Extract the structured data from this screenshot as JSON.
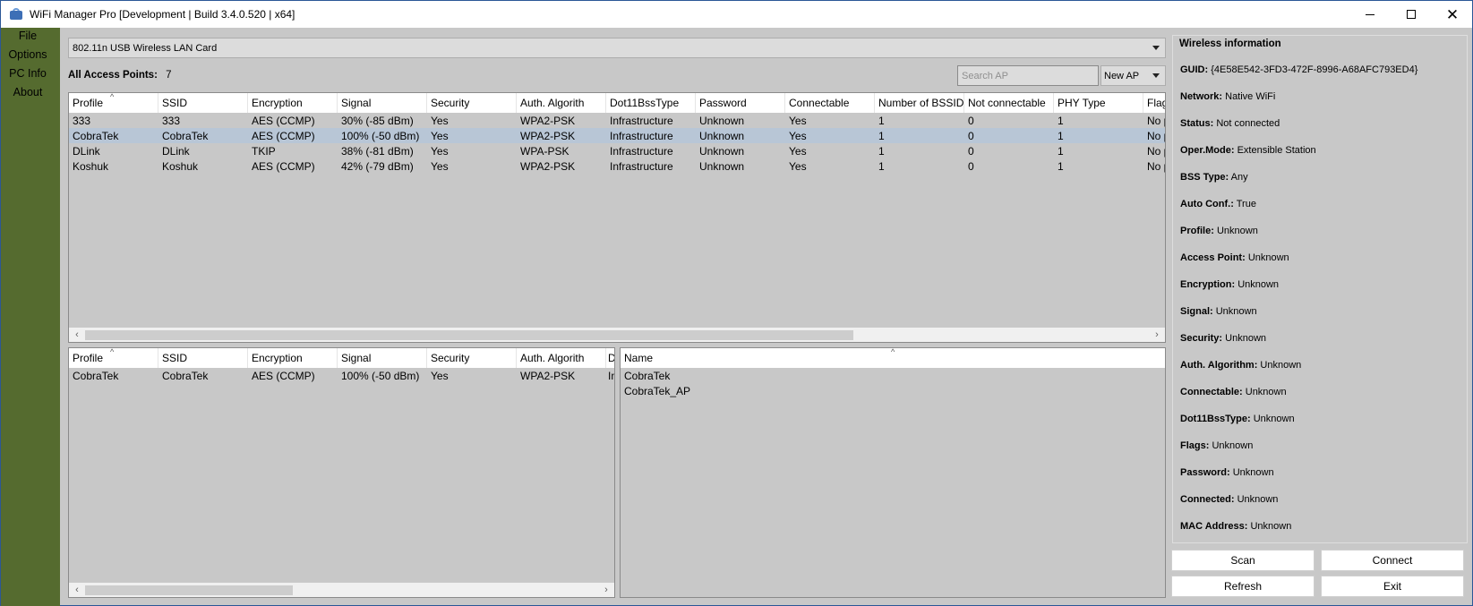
{
  "window": {
    "title": "WiFi Manager Pro [Development | Build 3.4.0.520 | x64]",
    "close_glyph": "✕"
  },
  "sidebar": {
    "items": [
      {
        "label": "File"
      },
      {
        "label": "Options"
      },
      {
        "label": "PC Info"
      },
      {
        "label": "About"
      }
    ]
  },
  "device": {
    "selected": "802.11n USB Wireless LAN Card"
  },
  "access_points": {
    "label": "All Access Points:",
    "count": "7"
  },
  "search": {
    "placeholder": "Search AP"
  },
  "new_ap": {
    "selected": "New AP"
  },
  "ap_table": {
    "columns": [
      "Profile",
      "SSID",
      "Encryption",
      "Signal",
      "Security",
      "Auth. Algorith",
      "Dot11BssType",
      "Password",
      "Connectable",
      "Number of BSSID",
      "Not connectable",
      "PHY Type",
      "Flags"
    ],
    "rows": [
      [
        "333",
        "333",
        "AES (CCMP)",
        "30% (-85 dBm)",
        "Yes",
        "WPA2-PSK",
        "Infrastructure",
        "Unknown",
        "Yes",
        "1",
        "0",
        "1",
        "No p"
      ],
      [
        "CobraTek",
        "CobraTek",
        "AES (CCMP)",
        "100% (-50 dBm)",
        "Yes",
        "WPA2-PSK",
        "Infrastructure",
        "Unknown",
        "Yes",
        "1",
        "0",
        "1",
        "No p"
      ],
      [
        "DLink",
        "DLink",
        "TKIP",
        "38% (-81 dBm)",
        "Yes",
        "WPA-PSK",
        "Infrastructure",
        "Unknown",
        "Yes",
        "1",
        "0",
        "1",
        "No p"
      ],
      [
        "Koshuk",
        "Koshuk",
        "AES (CCMP)",
        "42% (-79 dBm)",
        "Yes",
        "WPA2-PSK",
        "Infrastructure",
        "Unknown",
        "Yes",
        "1",
        "0",
        "1",
        "No p"
      ]
    ],
    "selected_row": 1
  },
  "selected_table": {
    "columns": [
      "Profile",
      "SSID",
      "Encryption",
      "Signal",
      "Security",
      "Auth. Algorith",
      "D"
    ],
    "rows": [
      [
        "CobraTek",
        "CobraTek",
        "AES (CCMP)",
        "100% (-50 dBm)",
        "Yes",
        "WPA2-PSK",
        "In"
      ]
    ]
  },
  "names_table": {
    "columns": [
      "Name"
    ],
    "rows": [
      [
        "CobraTek"
      ],
      [
        "CobraTek_AP"
      ]
    ]
  },
  "scroll_arrows": {
    "left": "‹",
    "right": "›",
    "sort": "^"
  },
  "info": {
    "title": "Wireless information",
    "fields": [
      {
        "key": "GUID:",
        "value": "{4E58E542-3FD3-472F-8996-A68AFC793ED4}"
      },
      {
        "key": "Network:",
        "value": "Native WiFi"
      },
      {
        "key": "Status:",
        "value": "Not connected"
      },
      {
        "key": "Oper.Mode:",
        "value": "Extensible Station"
      },
      {
        "key": "BSS Type:",
        "value": "Any"
      },
      {
        "key": "Auto Conf.:",
        "value": "True"
      },
      {
        "key": "Profile:",
        "value": "Unknown"
      },
      {
        "key": "Access Point:",
        "value": "Unknown"
      },
      {
        "key": "Encryption:",
        "value": "Unknown"
      },
      {
        "key": "Signal:",
        "value": "Unknown"
      },
      {
        "key": "Security:",
        "value": "Unknown"
      },
      {
        "key": "Auth. Algorithm:",
        "value": "Unknown"
      },
      {
        "key": "Connectable:",
        "value": "Unknown"
      },
      {
        "key": "Dot11BssType:",
        "value": "Unknown"
      },
      {
        "key": "Flags:",
        "value": "Unknown"
      },
      {
        "key": "Password:",
        "value": "Unknown"
      },
      {
        "key": "Connected:",
        "value": "Unknown"
      },
      {
        "key": "MAC Address:",
        "value": "Unknown"
      }
    ]
  },
  "buttons": {
    "scan": "Scan",
    "connect": "Connect",
    "refresh": "Refresh",
    "exit": "Exit"
  }
}
